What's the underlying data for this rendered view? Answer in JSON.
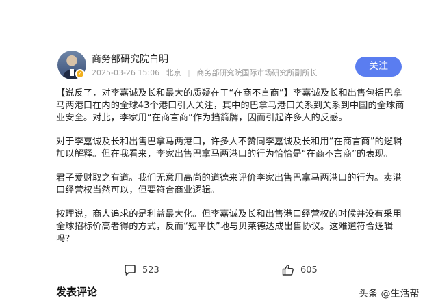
{
  "post": {
    "author_name": "商务部研究院白明",
    "timestamp": "2025-03-26 15:06",
    "location": "北京",
    "author_title": "商务部研究院国际市场研究所副所长",
    "follow_label": "关注"
  },
  "article": {
    "paragraphs": [
      "【说反了，对李嘉诚及长和最大的质疑在于“在商不言商”】李嘉诚及长和出售包括巴拿马两港口在内的全球43个港口引人关注，其中的巴拿马港口关系到关系到中国的全球商业安全。对此，李家用“在商言商”作为挡箭牌，因而引起许多人的反感。",
      "对于李嘉诚及长和出售巴拿马两港口，许多人不赞同李嘉诚及长和用“在商言商”的逻辑加以解释。但在我看来，李家出售巴拿马两港口的行为恰恰是“在商不言商”的表现。",
      "君子爱财取之有道。我们无意用高尚的道德来评价李家出售巴拿马两港口的行为。卖港口经营权当然可以，但要符合商业逻辑。",
      "按理说，商人追求的是利益最大化。但李嘉诚及长和出售港口经营权的时候并没有采用全球招标价高者得的方式，反而“短平快”地与贝莱德达成出售协议。这难道符合逻辑吗？"
    ]
  },
  "actions": {
    "comment_count": "523",
    "like_count": "605"
  },
  "comments": {
    "title": "发表评论"
  },
  "watermark": {
    "text": "头条 @生活帮"
  },
  "colors": {
    "accent": "#5a7df0",
    "meta_text": "#9a9a9a",
    "badge": "#f2b01e"
  },
  "icons": {
    "comment": "comment-bubble-icon",
    "like": "thumbs-up-icon",
    "verify": "verified-badge-icon"
  }
}
